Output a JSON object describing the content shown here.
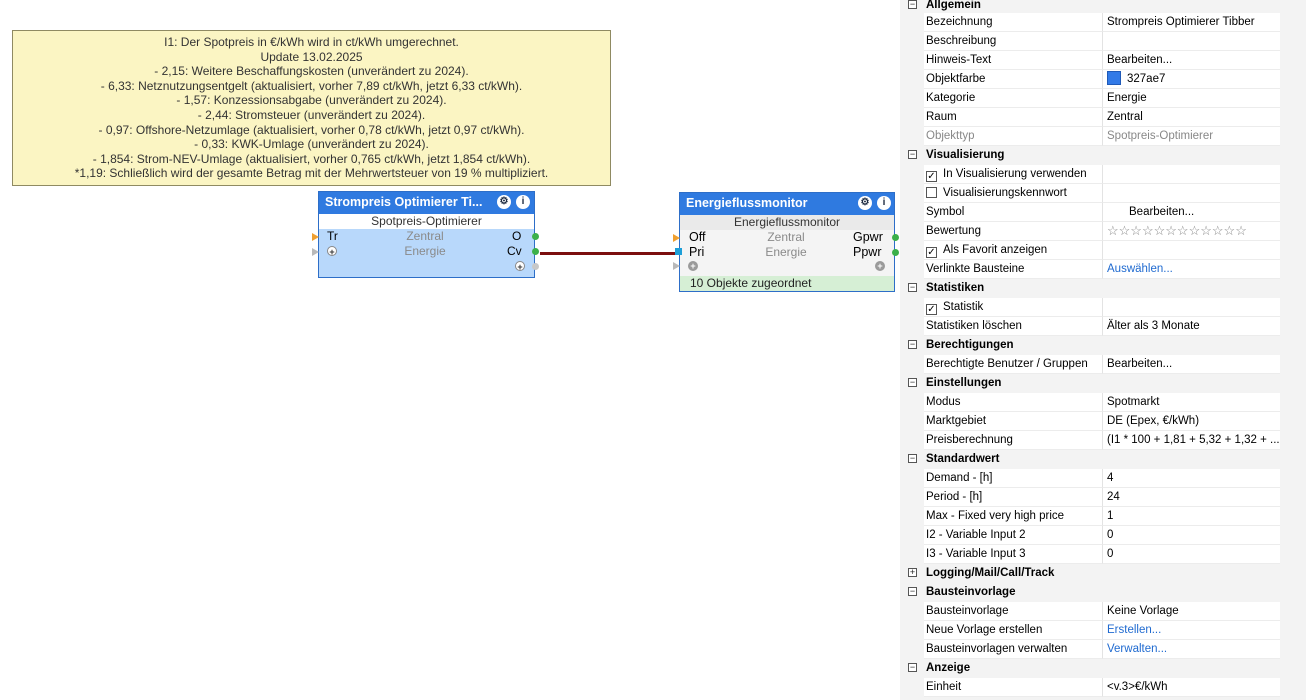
{
  "note": {
    "lines": [
      "I1: Der Spotpreis in €/kWh wird in ct/kWh umgerechnet.",
      "Update 13.02.2025",
      "- 2,15: Weitere Beschaffungskosten (unverändert zu 2024).",
      "- 6,33: Netznutzungsentgelt (aktualisiert, vorher 7,89 ct/kWh, jetzt 6,33 ct/kWh).",
      "- 1,57: Konzessionsabgabe (unverändert zu 2024).",
      "- 2,44: Stromsteuer (unverändert zu 2024).",
      "- 0,97: Offshore-Netzumlage (aktualisiert, vorher 0,78 ct/kWh, jetzt 0,97 ct/kWh).",
      "- 0,33: KWK-Umlage (unverändert zu 2024).",
      "- 1,854: Strom-NEV-Umlage (aktualisiert, vorher 0,765 ct/kWh, jetzt 1,854 ct/kWh).",
      "*1,19: Schließlich wird der gesamte Betrag mit der Mehrwertsteuer von 19 % multipliziert."
    ]
  },
  "block1": {
    "title": "Strompreis Optimierer Ti...",
    "type": "Spotpreis-Optimierer",
    "in1": "Tr",
    "out1": "O",
    "out2": "Cv",
    "room": "Zentral",
    "category": "Energie"
  },
  "block2": {
    "title": "Energieflussmonitor",
    "type": "Energieflussmonitor",
    "in1": "Off",
    "in2": "Pri",
    "out1": "Gpwr",
    "out2": "Ppwr",
    "room": "Zentral",
    "category": "Energie",
    "footer": "10 Objekte zugeordnet"
  },
  "panel": {
    "sections": {
      "allgemein": "Allgemein",
      "visualisierung": "Visualisierung",
      "statistiken": "Statistiken",
      "berechtigungen": "Berechtigungen",
      "einstellungen": "Einstellungen",
      "standardwert": "Standardwert",
      "logging": "Logging/Mail/Call/Track",
      "bausteinvorlage": "Bausteinvorlage",
      "anzeige": "Anzeige"
    },
    "rows": {
      "bezeichnung": [
        "Bezeichnung",
        "Strompreis Optimierer Tibber"
      ],
      "beschreibung": [
        "Beschreibung",
        ""
      ],
      "hinweis": [
        "Hinweis-Text",
        "Bearbeiten..."
      ],
      "objektfarbe": [
        "Objektfarbe",
        "327ae7"
      ],
      "kategorie": [
        "Kategorie",
        "Energie"
      ],
      "raum": [
        "Raum",
        "Zentral"
      ],
      "objekttyp": [
        "Objekttyp",
        "Spotpreis-Optimierer"
      ],
      "invis": [
        "In Visualisierung verwenden",
        ""
      ],
      "viskenn": [
        "Visualisierungskennwort",
        ""
      ],
      "symbol": [
        "Symbol",
        "Bearbeiten..."
      ],
      "bewertung": [
        "Bewertung",
        "☆☆☆☆☆☆☆☆☆☆☆☆"
      ],
      "favorit": [
        "Als Favorit anzeigen",
        ""
      ],
      "verlinkt": [
        "Verlinkte Bausteine",
        "Auswählen..."
      ],
      "statistik": [
        "Statistik",
        ""
      ],
      "statloeschen": [
        "Statistiken löschen",
        "Älter als 3 Monate"
      ],
      "berechtigte": [
        "Berechtigte Benutzer / Gruppen",
        "Bearbeiten..."
      ],
      "modus": [
        "Modus",
        "Spotmarkt"
      ],
      "marktgebiet": [
        "Marktgebiet",
        "DE (Epex, €/kWh)"
      ],
      "preisberechnung": [
        "Preisberechnung",
        "(I1 * 100 + 1,81 + 5,32 + 1,32 + ..."
      ],
      "demand": [
        "Demand -  [h]",
        "4"
      ],
      "period": [
        "Period -  [h]",
        "24"
      ],
      "maxfixed": [
        "Max - Fixed very high price",
        "1"
      ],
      "i2": [
        "I2 - Variable Input 2",
        "0"
      ],
      "i3": [
        "I3 - Variable Input 3",
        "0"
      ],
      "bvorlage": [
        "Bausteinvorlage",
        "Keine Vorlage"
      ],
      "neuevorlage": [
        "Neue Vorlage erstellen",
        "Erstellen..."
      ],
      "verwalten": [
        "Bausteinvorlagen verwalten",
        "Verwalten..."
      ],
      "einheit": [
        "Einheit",
        "<v.3>€/kWh"
      ]
    }
  },
  "colors": {
    "objektfarbe": "#327ae7",
    "note_bg": "#fbf5c3",
    "wire": "#7b0e0e",
    "link": "#1f6ad0"
  }
}
